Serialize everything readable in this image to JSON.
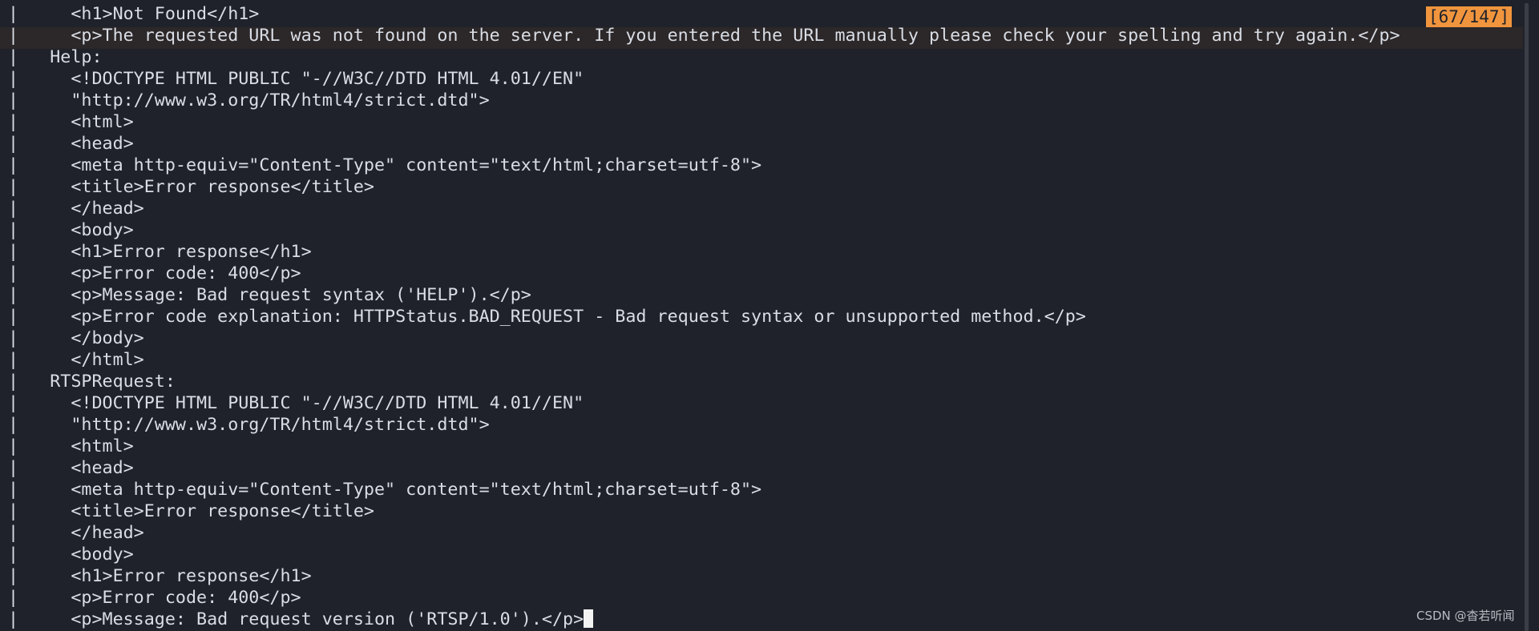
{
  "terminal": {
    "lines": [
      "|     <h1>Not Found</h1>",
      "|     <p>The requested URL was not found on the server. If you entered the URL manually please check your spelling and try again.</p>",
      "|   Help:",
      "|     <!DOCTYPE HTML PUBLIC \"-//W3C//DTD HTML 4.01//EN\"",
      "|     \"http://www.w3.org/TR/html4/strict.dtd\">",
      "|     <html>",
      "|     <head>",
      "|     <meta http-equiv=\"Content-Type\" content=\"text/html;charset=utf-8\">",
      "|     <title>Error response</title>",
      "|     </head>",
      "|     <body>",
      "|     <h1>Error response</h1>",
      "|     <p>Error code: 400</p>",
      "|     <p>Message: Bad request syntax ('HELP').</p>",
      "|     <p>Error code explanation: HTTPStatus.BAD_REQUEST - Bad request syntax or unsupported method.</p>",
      "|     </body>",
      "|     </html>",
      "|   RTSPRequest:",
      "|     <!DOCTYPE HTML PUBLIC \"-//W3C//DTD HTML 4.01//EN\"",
      "|     \"http://www.w3.org/TR/html4/strict.dtd\">",
      "|     <html>",
      "|     <head>",
      "|     <meta http-equiv=\"Content-Type\" content=\"text/html;charset=utf-8\">",
      "|     <title>Error response</title>",
      "|     </head>",
      "|     <body>",
      "|     <h1>Error response</h1>",
      "|     <p>Error code: 400</p>",
      "|     <p>Message: Bad request version ('RTSP/1.0').</p>"
    ]
  },
  "pager": {
    "position": "[67/147]"
  },
  "watermark": "CSDN @杳若听闻",
  "colors": {
    "background": "#1f222a",
    "text": "#d9dde5",
    "badge": "#f0953e"
  }
}
